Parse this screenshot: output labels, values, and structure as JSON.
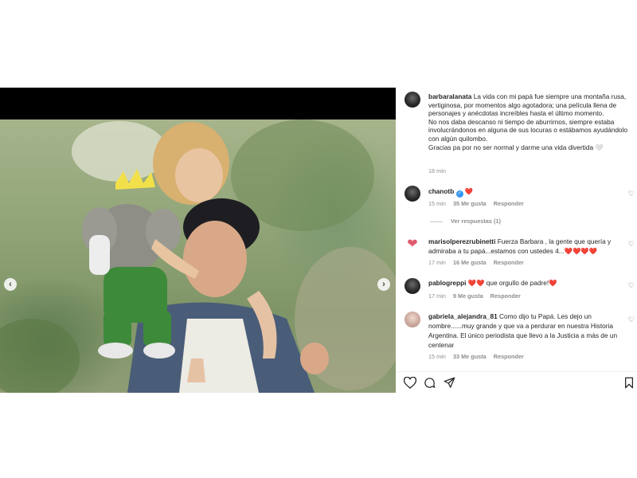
{
  "post": {
    "author": "barbaralanata",
    "caption_lines": [
      "La vida con mi papá fue siempre una montaña rusa, vertiginosa, por momentos algo agotadora; una película llena de personajes y anécdotas increíbles hasta el último momento.",
      "No nos daba descanso ni tiempo de aburrirnos, siempre estaba involucrándonos en alguna de sus locuras o estábamos ayudándolo con algún quilombo.",
      "Gracias pa por no ser normal y darme una vida divertida 🤍"
    ],
    "time": "18 min"
  },
  "comments": [
    {
      "user": "chanotb",
      "verified": true,
      "text": "❤️",
      "time": "15 min",
      "likes": "35 Me gusta",
      "reply": "Responder",
      "view_replies": "Ver respuestas (1)"
    },
    {
      "user": "marisolperezrubinetti",
      "text": "Fuerza Barbara , la gente que quería y admiraba a tu papá...estamos con ustedes 4...❤️❤️❤️❤️",
      "time": "17 min",
      "likes": "16 Me gusta",
      "reply": "Responder"
    },
    {
      "user": "pablogreppi",
      "text": "❤️❤️ que orgullo de padre!❤️",
      "time": "17 min",
      "likes": "9 Me gusta",
      "reply": "Responder"
    },
    {
      "user": "gabriela_alejandra_81",
      "text": "Como dijo tu Papá. Les dejo un nombre......muy grande y que va a perdurar en nuestra Historia Argentina. El único periodista que llevo a la Justicia a más de un centenar",
      "time": "15 min",
      "likes": "33 Me gusta",
      "reply": "Responder"
    }
  ],
  "icons": {
    "prev": "chevron-left-icon",
    "next": "chevron-right-icon",
    "like": "heart-icon",
    "comment": "comment-icon",
    "share": "send-icon",
    "save": "bookmark-icon"
  },
  "colors": {
    "text": "#262626",
    "muted": "#8e8e8e",
    "verified": "#3897f0",
    "heart": "#e0245e"
  }
}
